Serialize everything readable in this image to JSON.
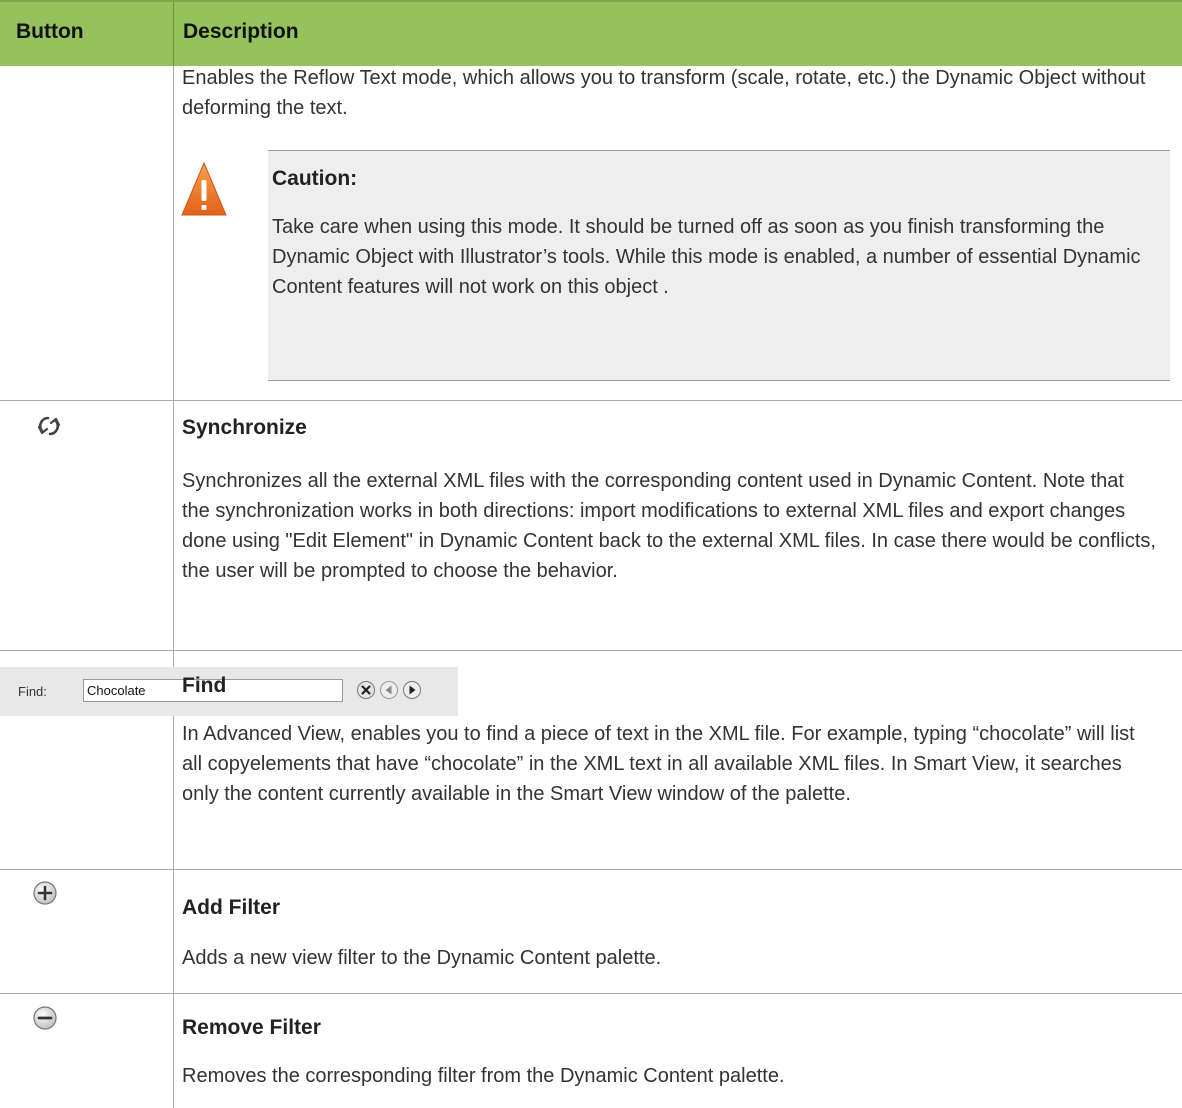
{
  "header": {
    "col_button": "Button",
    "col_description": "Description"
  },
  "reflow": {
    "description": "Enables the Reflow Text mode, which allows you to transform (scale, rotate, etc.) the Dynamic Object without deforming the text.",
    "caution_title": "Caution:",
    "caution_text": "Take care when using this mode. It should be turned off as soon as you finish transforming the Dynamic Object with Illustrator’s tools. While this mode is enabled, a number of essential Dynamic Content features will not work on this object ."
  },
  "synchronize": {
    "title": "Synchronize",
    "description": "Synchronizes all the external XML files with the corresponding content used in Dynamic Content. Note that the synchronization works in both directions: import modifications to external XML files and export changes done using \"Edit Element\" in Dynamic Content back to the external XML files. In case there would be conflicts, the user will be prompted to choose the behavior."
  },
  "find": {
    "title": "Find",
    "bar_label": "Find:",
    "field_value": "Chocolate",
    "description": "In Advanced View, enables you to find a piece of text in the XML file. For example, typing “chocolate” will list all copyelements that have “chocolate” in the XML text in all available XML files. In Smart View, it searches only the content currently available in the Smart View window of the palette."
  },
  "add_filter": {
    "title": "Add Filter",
    "description": "Adds a new view filter to the Dynamic Content palette."
  },
  "remove_filter": {
    "title": "Remove Filter",
    "description": "Removes the corresponding filter from the Dynamic Content palette."
  },
  "icons": {
    "warning": "warning-triangle-icon",
    "synchronize": "sync-icon",
    "clear": "clear-icon",
    "previous": "previous-icon",
    "next": "next-icon",
    "add": "plus-circle-icon",
    "remove": "minus-circle-icon"
  },
  "colors": {
    "header_bg": "#96c25d",
    "caution_bg": "#eeeeee",
    "warning": "#f07d2a"
  }
}
